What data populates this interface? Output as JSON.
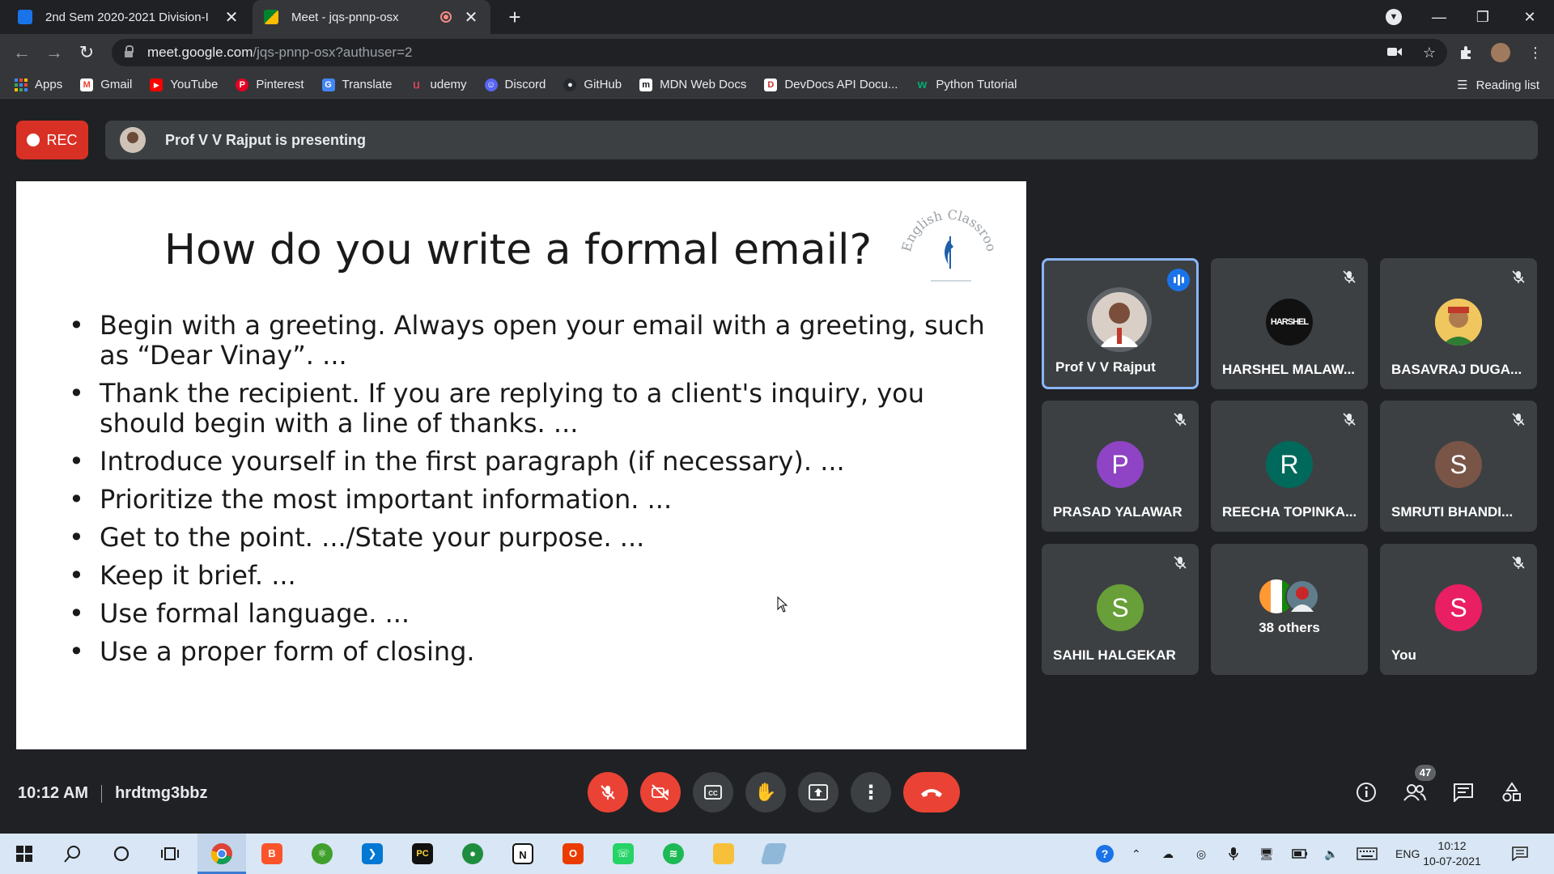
{
  "browser": {
    "tabs": [
      {
        "title": "2nd Sem 2020-2021 Division-I",
        "active": false,
        "favicon_color": "#1a73e8"
      },
      {
        "title": "Meet - jqs-pnnp-osx",
        "active": true,
        "favicon_color": "#00832d"
      }
    ],
    "url_host": "meet.google.com",
    "url_path": "/jqs-pnnp-osx?authuser=2",
    "bookmarks": [
      {
        "label": "Apps",
        "icon": "apps-grid-icon",
        "color": "#4285f4"
      },
      {
        "label": "Gmail",
        "icon": "gmail-icon",
        "color": "#ea4335"
      },
      {
        "label": "YouTube",
        "icon": "youtube-icon",
        "color": "#ff0000"
      },
      {
        "label": "Pinterest",
        "icon": "pinterest-icon",
        "color": "#e60023"
      },
      {
        "label": "Translate",
        "icon": "translate-icon",
        "color": "#4285f4"
      },
      {
        "label": "udemy",
        "icon": "udemy-icon",
        "color": "#a435f0"
      },
      {
        "label": "Discord",
        "icon": "discord-icon",
        "color": "#5865f2"
      },
      {
        "label": "GitHub",
        "icon": "github-icon",
        "color": "#24292e"
      },
      {
        "label": "MDN Web Docs",
        "icon": "mdn-icon",
        "color": "#15141a"
      },
      {
        "label": "DevDocs API Docu...",
        "icon": "devdocs-icon",
        "color": "#c53030"
      },
      {
        "label": "Python Tutorial",
        "icon": "w3schools-icon",
        "color": "#04aa6d"
      }
    ],
    "reading_list": "Reading list"
  },
  "meet": {
    "rec_label": "REC",
    "presenting_text": "Prof V V Rajput is presenting",
    "slide": {
      "title": "How do you write a formal email?",
      "logo_text": "English Classroom",
      "bullets": [
        "Begin with a greeting. Always open your email with a greeting, such as “Dear Vinay”. ...",
        "Thank the recipient. If you are replying to a client's inquiry, you should begin with a line of thanks. ...",
        "Introduce yourself in the first paragraph (if necessary). ...",
        "Prioritize the most important information. ...",
        "Get to the point. .../State your purpose. ...",
        "Keep it brief. ...",
        "Use formal language. ...",
        "Use a proper form of closing."
      ]
    },
    "participants": [
      {
        "name": "Prof V V Rajput",
        "letter": "",
        "color": "#c9b7a8",
        "speaking": true,
        "muted": false
      },
      {
        "name": "HARSHEL MALAW...",
        "letter": "HARSHEL",
        "color": "#111111",
        "speaking": false,
        "muted": true
      },
      {
        "name": "BASAVRAJ DUGA...",
        "letter": "",
        "color": "#e6b84a",
        "speaking": false,
        "muted": true
      },
      {
        "name": "PRASAD YALAWAR",
        "letter": "P",
        "color": "#8e44c4",
        "speaking": false,
        "muted": true
      },
      {
        "name": "REECHA TOPINKA...",
        "letter": "R",
        "color": "#00695c",
        "speaking": false,
        "muted": true
      },
      {
        "name": "SMRUTI BHANDI...",
        "letter": "S",
        "color": "#795548",
        "speaking": false,
        "muted": true
      },
      {
        "name": "SAHIL HALGEKAR",
        "letter": "S",
        "color": "#689f38",
        "speaking": false,
        "muted": true
      },
      {
        "name": "You",
        "letter": "S",
        "color": "#e91e63",
        "speaking": false,
        "muted": true
      }
    ],
    "others_label": "38 others",
    "time": "10:12 AM",
    "meeting_code": "hrdtmg3bbz",
    "participant_count": "47"
  },
  "taskbar": {
    "language": "ENG",
    "time": "10:12",
    "date": "10-07-2021"
  }
}
